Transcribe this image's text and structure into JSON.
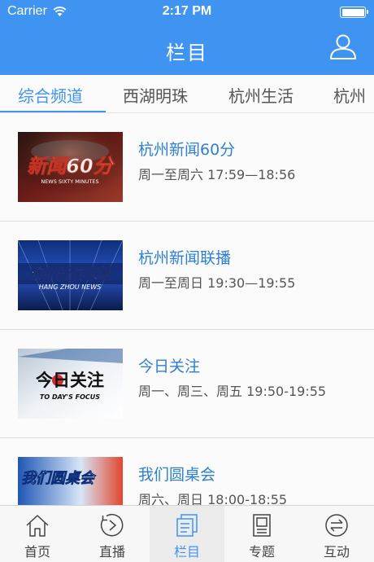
{
  "status_bar": {
    "carrier": "Carrier",
    "time": "2:17 PM"
  },
  "nav": {
    "title": "栏目",
    "user_icon": "user-icon"
  },
  "tabs": [
    {
      "label": "综合频道",
      "active": true
    },
    {
      "label": "西湖明珠",
      "active": false
    },
    {
      "label": "杭州生活",
      "active": false
    },
    {
      "label": "杭州",
      "active": false
    }
  ],
  "programs": [
    {
      "title": "杭州新闻60分",
      "schedule": "周一至周六 17:59—18:56",
      "logo_text": "新闻60分",
      "logo_sub": "NEWS SIXTY MINUTES"
    },
    {
      "title": "杭州新闻联播",
      "schedule": "周一至周日 19:30—19:55",
      "logo_text": "杭州新闻联播",
      "logo_sub": "HANG ZHOU NEWS"
    },
    {
      "title": "今日关注",
      "schedule": "周一、周三、周五 19:50-19:55",
      "logo_text": "今日关注",
      "logo_sub": "TO DAY'S FOCUS"
    },
    {
      "title": "我们圆桌会",
      "schedule": "周六、周日  18:00-18:55",
      "logo_text": "我们圆桌会",
      "logo_sub": ""
    }
  ],
  "tabbar": [
    {
      "label": "首页",
      "icon": "home-icon",
      "active": false
    },
    {
      "label": "直播",
      "icon": "live-icon",
      "active": false
    },
    {
      "label": "栏目",
      "icon": "columns-icon",
      "active": true
    },
    {
      "label": "专题",
      "icon": "topic-icon",
      "active": false
    },
    {
      "label": "互动",
      "icon": "interact-icon",
      "active": false
    }
  ],
  "colors": {
    "accent": "#3f94f2",
    "title_blue": "#2d7fd6"
  }
}
